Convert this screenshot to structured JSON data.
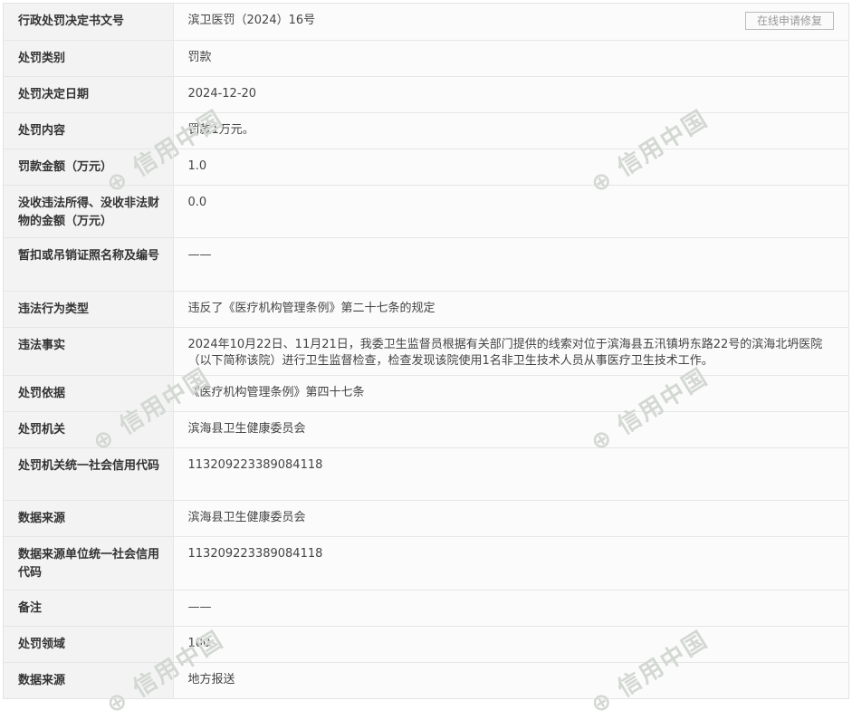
{
  "repair_button": "在线申请修复",
  "watermark": "信用中国",
  "rows": [
    {
      "label": "行政处罚决定书文号",
      "value": "滨卫医罚（2024）16号"
    },
    {
      "label": "处罚类别",
      "value": "罚款"
    },
    {
      "label": "处罚决定日期",
      "value": "2024-12-20"
    },
    {
      "label": "处罚内容",
      "value": "罚款1万元。"
    },
    {
      "label": "罚款金额（万元）",
      "value": "1.0"
    },
    {
      "label": "没收违法所得、没收非法财物的金额（万元）",
      "value": "0.0"
    },
    {
      "label": "暂扣或吊销证照名称及编号",
      "value": "——"
    },
    {
      "label": "违法行为类型",
      "value": "违反了《医疗机构管理条例》第二十七条的规定"
    },
    {
      "label": "违法事实",
      "value": "2024年10月22日、11月21日，我委卫生监督员根据有关部门提供的线索对位于滨海县五汛镇坍东路22号的滨海北坍医院（以下简称该院）进行卫生监督检查，检查发现该院使用1名非卫生技术人员从事医疗卫生技术工作。"
    },
    {
      "label": "处罚依据",
      "value": "《医疗机构管理条例》第四十七条"
    },
    {
      "label": "处罚机关",
      "value": "滨海县卫生健康委员会"
    },
    {
      "label": "处罚机关统一社会信用代码",
      "value": "113209223389084118"
    },
    {
      "label": "数据来源",
      "value": "滨海县卫生健康委员会"
    },
    {
      "label": "数据来源单位统一社会信用代码",
      "value": "113209223389084118"
    },
    {
      "label": "备注",
      "value": "——"
    },
    {
      "label": "处罚领域",
      "value": "100"
    },
    {
      "label": "数据来源",
      "value": "地方报送"
    }
  ]
}
